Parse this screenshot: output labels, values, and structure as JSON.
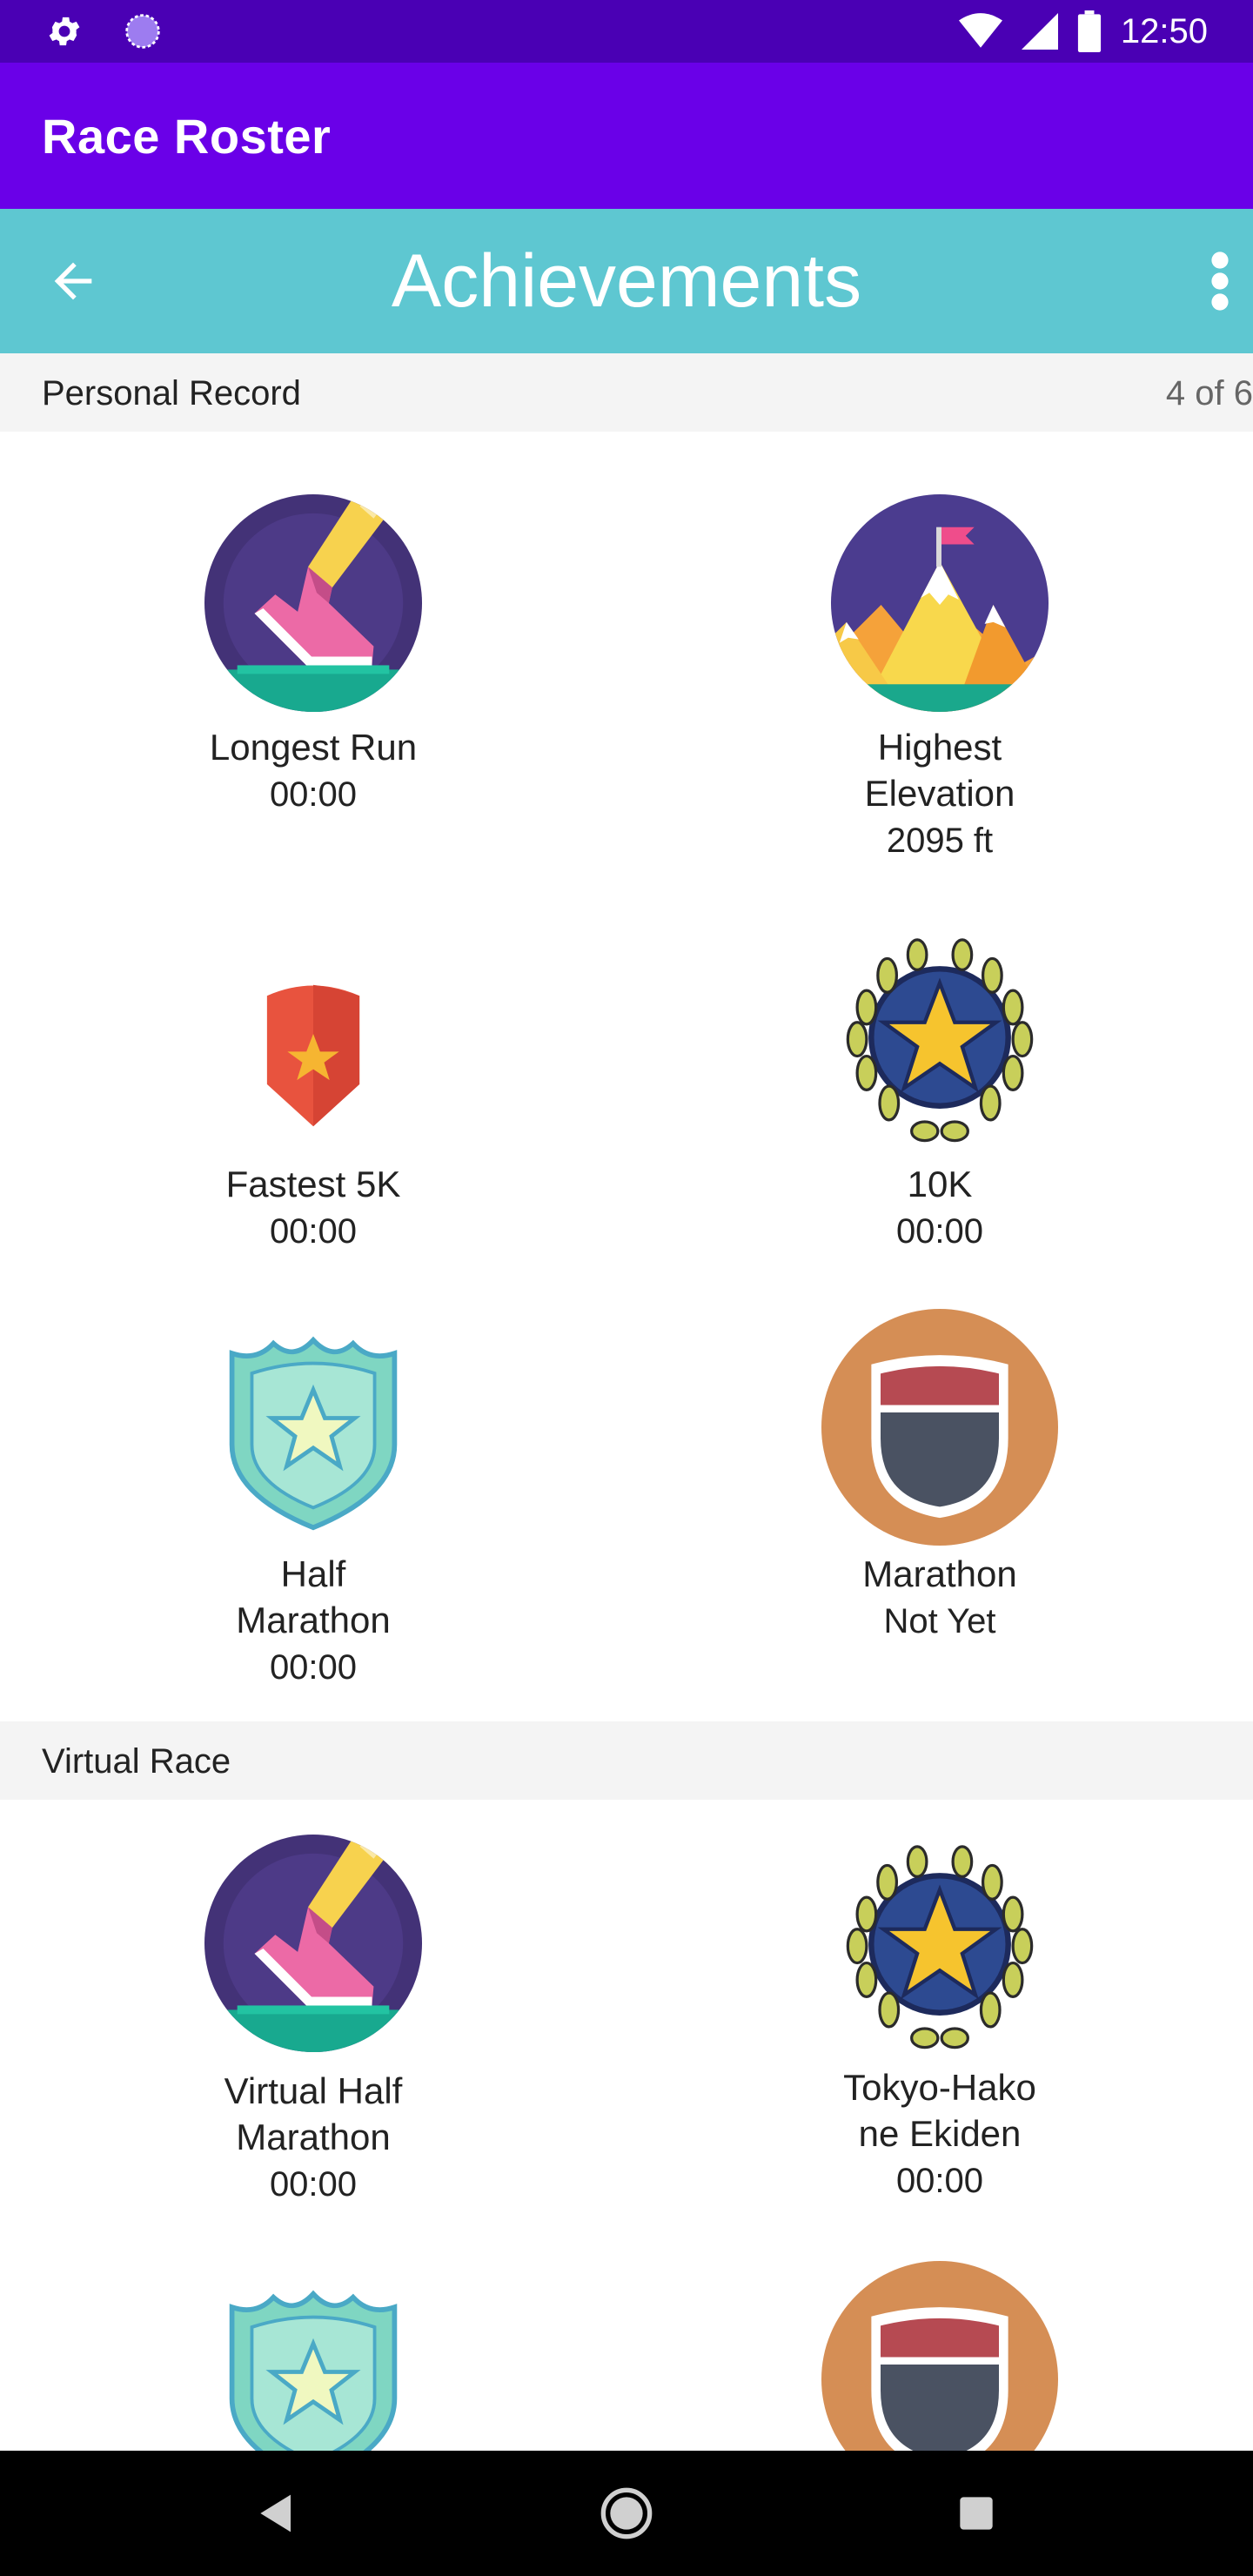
{
  "status_bar": {
    "time": "12:50"
  },
  "app_bar": {
    "title": "Race Roster"
  },
  "toolbar": {
    "title": "Achievements"
  },
  "sections": [
    {
      "label": "Personal Record",
      "count": "4 of 6"
    },
    {
      "label": "Virtual Race"
    }
  ],
  "personal_record": [
    {
      "icon": "running-shoe-icon",
      "name": "Longest Run",
      "value": "00:00"
    },
    {
      "icon": "mountain-flag-icon",
      "name": "Highest Elevation",
      "value": "2095 ft"
    },
    {
      "icon": "red-shield-star-icon",
      "name": "Fastest 5K",
      "value": "00:00"
    },
    {
      "icon": "laurel-star-medal-icon",
      "name": "10K",
      "value": "00:00"
    },
    {
      "icon": "green-badge-star-icon",
      "name": "Half Marathon",
      "value": "00:00"
    },
    {
      "icon": "highway-shield-icon",
      "name": "Marathon",
      "value": "Not Yet"
    }
  ],
  "virtual_race": [
    {
      "icon": "running-shoe-icon",
      "name": "Virtual Half Marathon",
      "value": "00:00"
    },
    {
      "icon": "laurel-star-medal-icon",
      "name": "Tokyo-Hakone Ekiden",
      "value": "00:00"
    },
    {
      "icon": "green-badge-star-icon",
      "name": "",
      "value": ""
    },
    {
      "icon": "highway-shield-icon",
      "name": "",
      "value": ""
    }
  ],
  "colors": {
    "status_bar": "#4a00b4",
    "app_bar": "#6a00e8",
    "toolbar": "#5ec7d1",
    "section_bg": "#f4f4f4"
  }
}
